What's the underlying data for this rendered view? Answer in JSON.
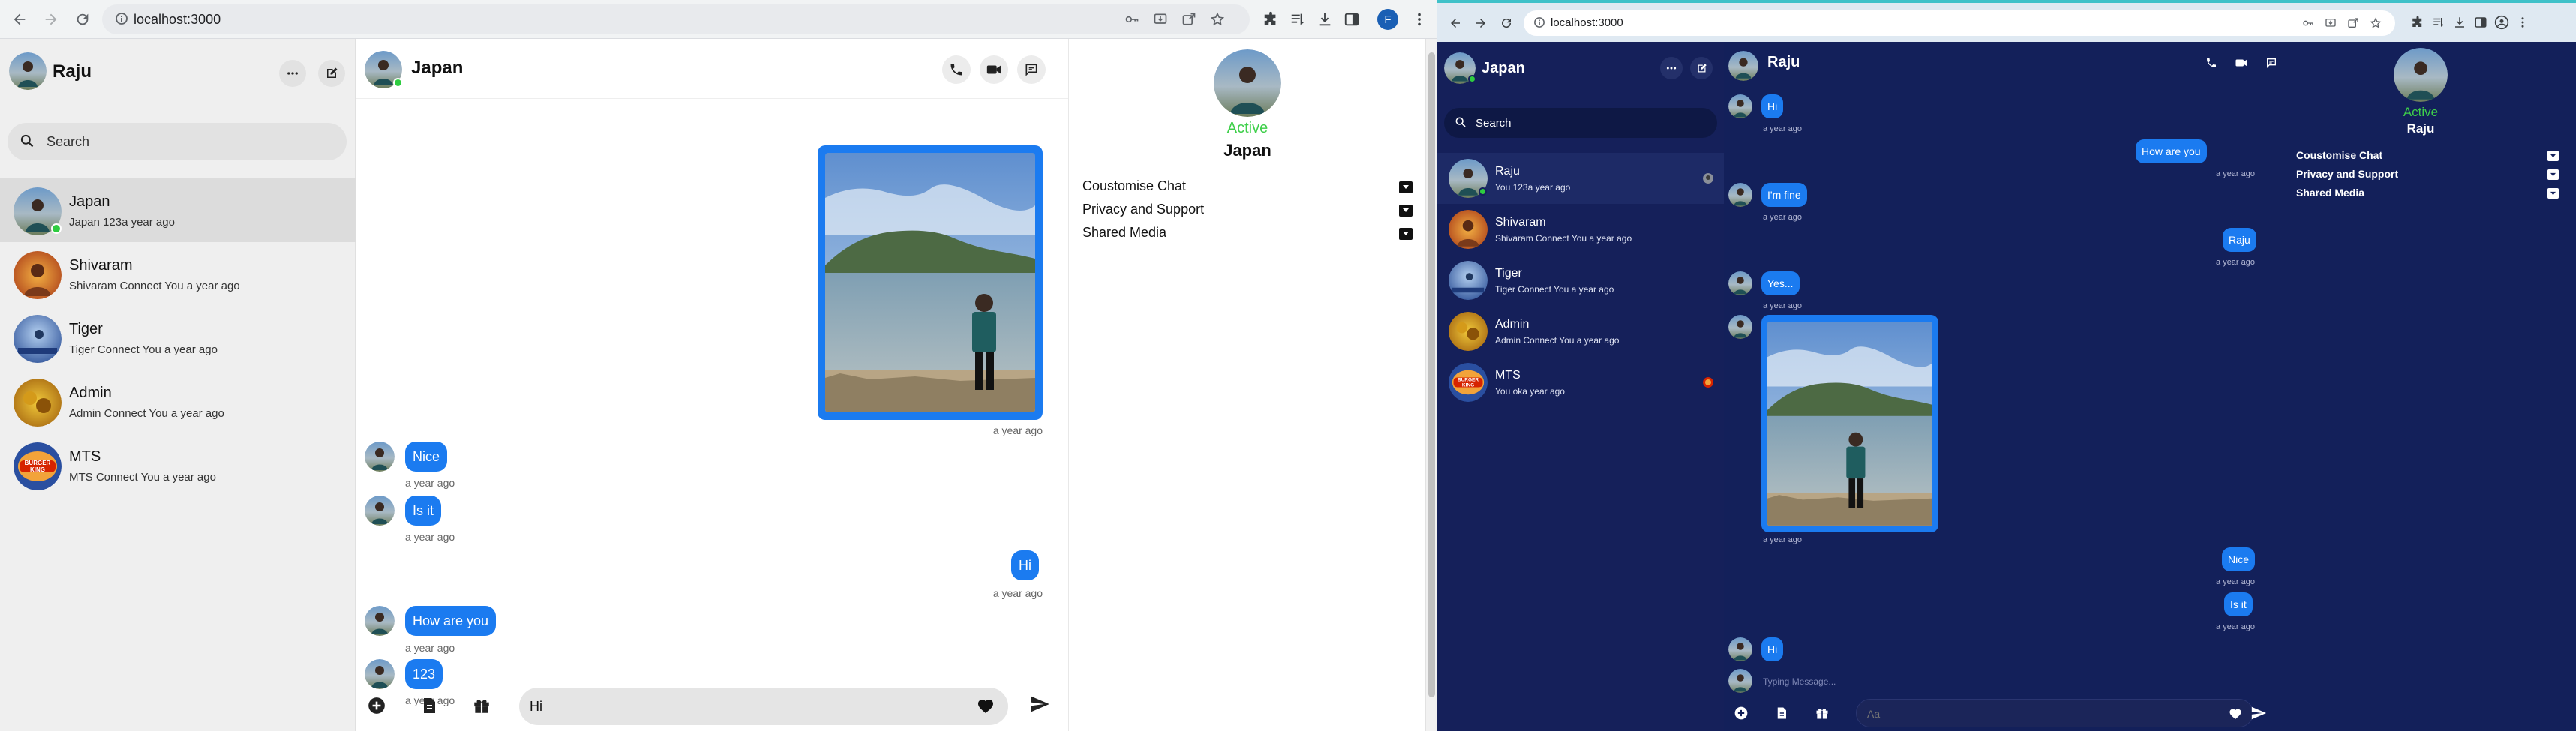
{
  "colors": {
    "accent": "#1b7bf0",
    "active_green": "#3ecf4a",
    "dark_bg": "#13205a",
    "light_sidebar": "#efefef"
  },
  "left_window": {
    "browser": {
      "url": "localhost:3000",
      "profile_initial": "F"
    },
    "current_user": {
      "name": "Raju"
    },
    "search": {
      "placeholder": "Search"
    },
    "contacts": [
      {
        "name": "Japan",
        "subtitle": "Japan 123a year ago",
        "online": true,
        "active": true
      },
      {
        "name": "Shivaram",
        "subtitle": "Shivaram Connect You a year ago"
      },
      {
        "name": "Tiger",
        "subtitle": "Tiger Connect You a year ago"
      },
      {
        "name": "Admin",
        "subtitle": "Admin Connect You a year ago"
      },
      {
        "name": "MTS",
        "subtitle": "MTS Connect You a year ago"
      }
    ],
    "chat": {
      "title": "Japan",
      "messages": {
        "image_time": "a year ago",
        "nice": "Nice",
        "nice_time": "a year ago",
        "isit": "Is it",
        "isit_time": "a year ago",
        "hi": "Hi",
        "hi_time": "a year ago",
        "howareyou": "How are you",
        "howareyou_time": "a year ago",
        "n123": "123",
        "n123_time": "a year ago"
      },
      "input_value": "Hi"
    },
    "info": {
      "status": "Active",
      "name": "Japan",
      "options": [
        "Coustomise Chat",
        "Privacy and Support",
        "Shared Media"
      ]
    }
  },
  "right_window": {
    "browser": {
      "url": "localhost:3000"
    },
    "current_user": {
      "name": "Japan"
    },
    "search": {
      "placeholder": "Search"
    },
    "contacts": [
      {
        "name": "Raju",
        "subtitle": "You 123a year ago",
        "online": true,
        "active": true
      },
      {
        "name": "Shivaram",
        "subtitle": "Shivaram Connect You a year ago"
      },
      {
        "name": "Tiger",
        "subtitle": "Tiger Connect You a year ago"
      },
      {
        "name": "Admin",
        "subtitle": "Admin Connect You a year ago"
      },
      {
        "name": "MTS",
        "subtitle": "You oka year ago"
      }
    ],
    "chat": {
      "title": "Raju",
      "messages": {
        "hi1": "Hi",
        "hi1_time": "a year ago",
        "howareyou": "How are you",
        "howareyou_time": "a year ago",
        "imfine": "I'm fine",
        "imfine_time": "a year ago",
        "raju": "Raju",
        "raju_time": "a year ago",
        "yes": "Yes...",
        "yes_time": "a year ago",
        "image_time": "a year ago",
        "nice": "Nice",
        "nice_time": "a year ago",
        "isit": "Is it",
        "isit_time": "a year ago",
        "hi2": "Hi"
      },
      "typing": "Typing Message...",
      "input_placeholder": "Aa"
    },
    "info": {
      "status": "Active",
      "name": "Raju",
      "options": [
        "Coustomise Chat",
        "Privacy and Support",
        "Shared Media"
      ]
    }
  }
}
